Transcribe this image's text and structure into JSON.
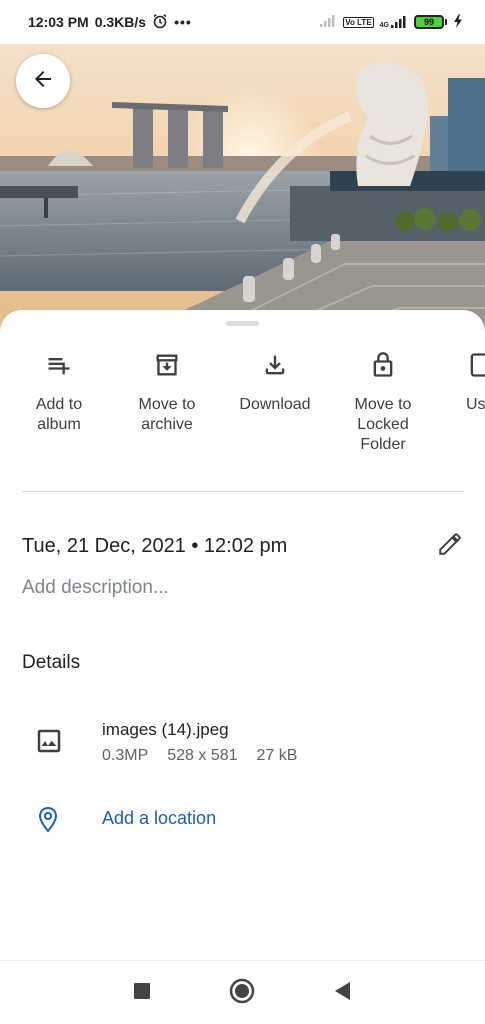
{
  "status_bar": {
    "time": "12:03 PM",
    "speed": "0.3KB/s",
    "battery": "99",
    "volte": "Vo LTE",
    "network": "4G"
  },
  "photo": {
    "description_icon": "photo-of-singapore-skyline"
  },
  "actions": [
    {
      "label": "Add to\nalbum",
      "icon": "playlist-add-icon"
    },
    {
      "label": "Move to\narchive",
      "icon": "archive-icon"
    },
    {
      "label": "Download",
      "icon": "download-icon"
    },
    {
      "label": "Move to\nLocked\nFolder",
      "icon": "lock-icon"
    },
    {
      "label": "Us",
      "icon": "device-icon"
    }
  ],
  "info": {
    "datetime": "Tue, 21 Dec, 2021 • 12:02 pm",
    "description_placeholder": "Add description...",
    "details_heading": "Details",
    "file_name": "images (14).jpeg",
    "megapixels": "0.3MP",
    "dimensions": "528 x 581",
    "size": "27 kB",
    "location_label": "Add a location"
  },
  "colors": {
    "accent": "#1a5fb4",
    "battery": "#4cd137"
  }
}
